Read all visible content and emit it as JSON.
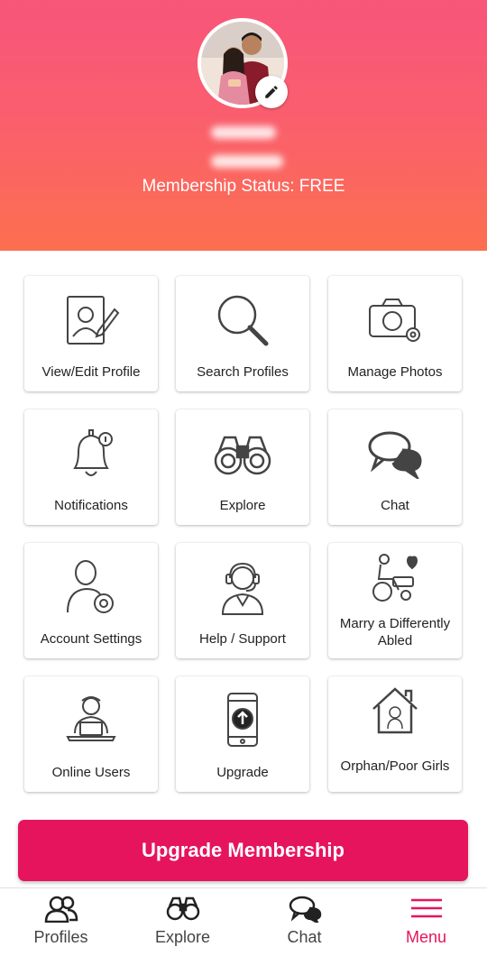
{
  "header": {
    "membership_status": "Membership Status: FREE"
  },
  "menu_tiles": [
    {
      "label": "View/Edit Profile",
      "icon": "edit-profile-icon"
    },
    {
      "label": "Search Profiles",
      "icon": "search-icon"
    },
    {
      "label": "Manage Photos",
      "icon": "camera-settings-icon"
    },
    {
      "label": "Notifications",
      "icon": "bell-icon"
    },
    {
      "label": "Explore",
      "icon": "binoculars-icon"
    },
    {
      "label": "Chat",
      "icon": "chat-bubbles-icon"
    },
    {
      "label": "Account Settings",
      "icon": "user-settings-icon"
    },
    {
      "label": "Help / Support",
      "icon": "headset-support-icon"
    },
    {
      "label": "Marry a Differently Abled",
      "icon": "wheelchair-heart-icon"
    },
    {
      "label": "Online Users",
      "icon": "user-laptop-icon"
    },
    {
      "label": "Upgrade",
      "icon": "phone-upgrade-icon"
    },
    {
      "label": "Orphan/Poor Girls",
      "icon": "house-girl-icon"
    }
  ],
  "upgrade_button": "Upgrade Membership",
  "bottom_nav": [
    {
      "label": "Profiles",
      "icon": "users-icon"
    },
    {
      "label": "Explore",
      "icon": "binoculars-icon"
    },
    {
      "label": "Chat",
      "icon": "chat-bubbles-icon"
    },
    {
      "label": "Menu",
      "icon": "hamburger-menu-icon",
      "active": true
    }
  ],
  "colors": {
    "accent": "#e5145c",
    "header_top": "#f8557a",
    "header_bottom": "#fc6f4f"
  }
}
